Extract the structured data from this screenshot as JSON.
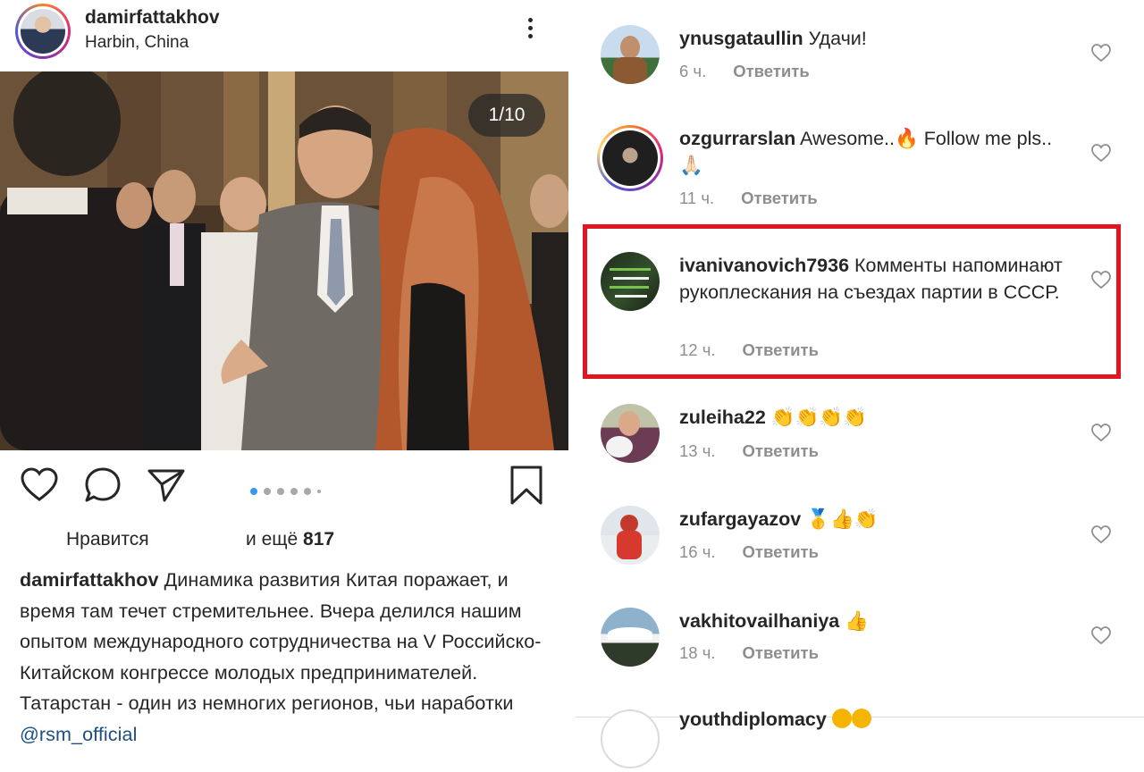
{
  "post": {
    "username": "damirfattakhov",
    "location": "Harbin, China",
    "carousel_counter": "1/10",
    "likes_label": "Нравится",
    "likes_more": "и ещё",
    "likes_count": "817",
    "caption_user": "damirfattakhov",
    "caption_text": "Динамика развития Китая поражает, и время там течет стремительнее. Вчера делился нашим опытом международного сотрудничества на V Российско-Китайском конгрессе молодых предпринимателей. Татарстан - один из немногих регионов, чьи наработки",
    "caption_mention": "@rsm_official",
    "carousel_progress": {
      "current": 1,
      "total": 10
    }
  },
  "comments": [
    {
      "user": "ynusgataullin",
      "text": "Удачи!",
      "time": "6 ч.",
      "reply": "Ответить"
    },
    {
      "user": "ozgurrarslan",
      "text": "Awesome..🔥 Follow me pls..🙏🏻",
      "time": "11 ч.",
      "reply": "Ответить"
    },
    {
      "user": "ivanivanovich7936",
      "text": "Комменты напоминают рукоплескания на съездах партии в СССР.",
      "time": "12 ч.",
      "reply": "Ответить"
    },
    {
      "user": "zuleiha22",
      "text": "👏👏👏👏",
      "time": "13 ч.",
      "reply": "Ответить"
    },
    {
      "user": "zufargayazov",
      "text": "🥇👍👏",
      "time": "16 ч.",
      "reply": "Ответить"
    },
    {
      "user": "vakhitovailhaniya",
      "text": "👍",
      "time": "18 ч.",
      "reply": "Ответить"
    },
    {
      "user": "youthdiplomacy",
      "text": "",
      "time": "",
      "reply": ""
    }
  ],
  "icons": {
    "more": "more-vertical-icon",
    "like": "heart-icon",
    "comment": "comment-bubble-icon",
    "share": "paper-plane-icon",
    "save": "bookmark-icon"
  },
  "colors": {
    "highlight_border": "#e0151f",
    "link": "#1d4f84",
    "active_dot": "#3897f0",
    "meta_grey": "#8e8e8e"
  }
}
